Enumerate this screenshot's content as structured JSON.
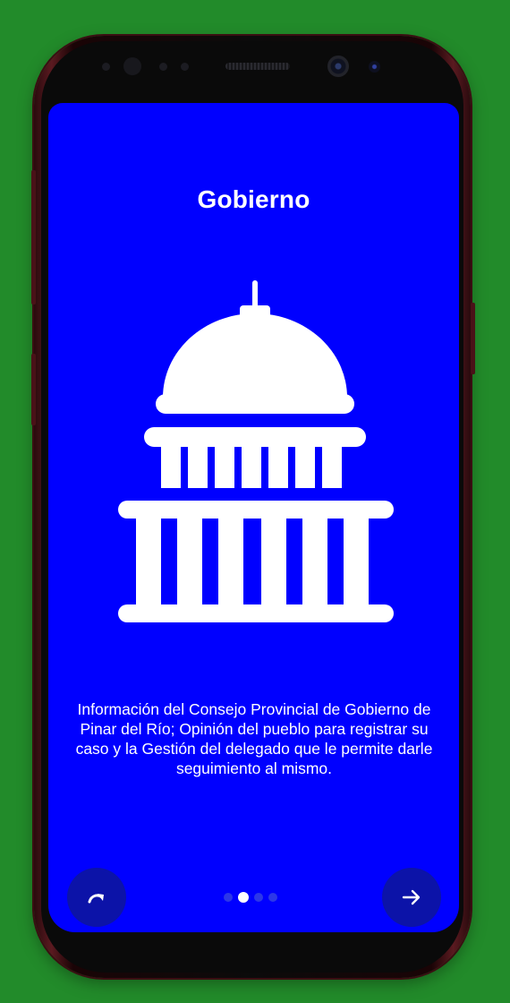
{
  "screen": {
    "title": "Gobierno",
    "description": "Información del Consejo Provincial de Gobierno de Pinar del Río; Opinión del pueblo para registrar su caso y la Gestión del delegado que le permite darle seguimiento al mismo.",
    "illustration_icon": "capitol-building-icon"
  },
  "pager": {
    "page_count": 4,
    "active_index": 1
  },
  "buttons": {
    "skip_icon": "redo-arrow-icon",
    "next_icon": "arrow-right-icon"
  },
  "colors": {
    "background": "#228B2A",
    "screen": "#0000FF",
    "button": "#0C13A8",
    "dot_inactive": "#2C37E8",
    "dot_active": "#FFFFFF"
  }
}
